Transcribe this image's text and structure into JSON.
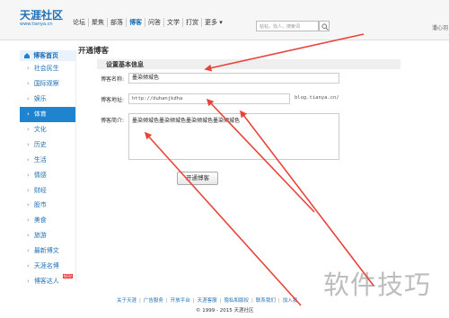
{
  "header": {
    "logo_text": "天涯社区",
    "logo_sub": "www.tianya.cn",
    "nav": [
      "论坛",
      "聚焦",
      "部落",
      "博客",
      "问答",
      "文学",
      "打赏",
      "更多 ▾"
    ],
    "active_nav": "博客",
    "search_placeholder": "帖帖，找人，搜索词",
    "topright": "潘心羽"
  },
  "sidebar": {
    "home_label": "博客首页",
    "items": [
      {
        "label": "社会民生"
      },
      {
        "label": "国际观察"
      },
      {
        "label": "娱乐"
      },
      {
        "label": "体育"
      },
      {
        "label": "文化"
      },
      {
        "label": "历史"
      },
      {
        "label": "生活"
      },
      {
        "label": "情感"
      },
      {
        "label": "财经"
      },
      {
        "label": "股市"
      },
      {
        "label": "美食"
      },
      {
        "label": "旅游"
      },
      {
        "label": "最新博文"
      },
      {
        "label": "天涯名博"
      },
      {
        "label": "博客达人",
        "badge": "NEW"
      }
    ],
    "active_item": "体育"
  },
  "main": {
    "title": "开通博客",
    "section_title": "设置基本信息",
    "blog_name_label": "博客名称:",
    "blog_name_value": "墨染倾城色",
    "blog_url_label": "博客地址:",
    "blog_url_value": "http://duhanjkdha",
    "blog_url_suffix": "blog.tianya.cn/",
    "blog_intro_label": "博客简介:",
    "blog_intro_value": "墨染倾城色墨染倾城色墨染倾城色墨染倾城色",
    "submit_label": "开通博客"
  },
  "footer": {
    "links": [
      "关于天涯",
      "广告服务",
      "开放平台",
      "天涯客服",
      "隐私和版权",
      "联系我们",
      "加入我"
    ],
    "copyright": "© 1999 - 2015 天涯社区"
  },
  "watermark": "软件技巧",
  "colors": {
    "accent": "#1f84d0",
    "arrow": "#e8443a"
  }
}
